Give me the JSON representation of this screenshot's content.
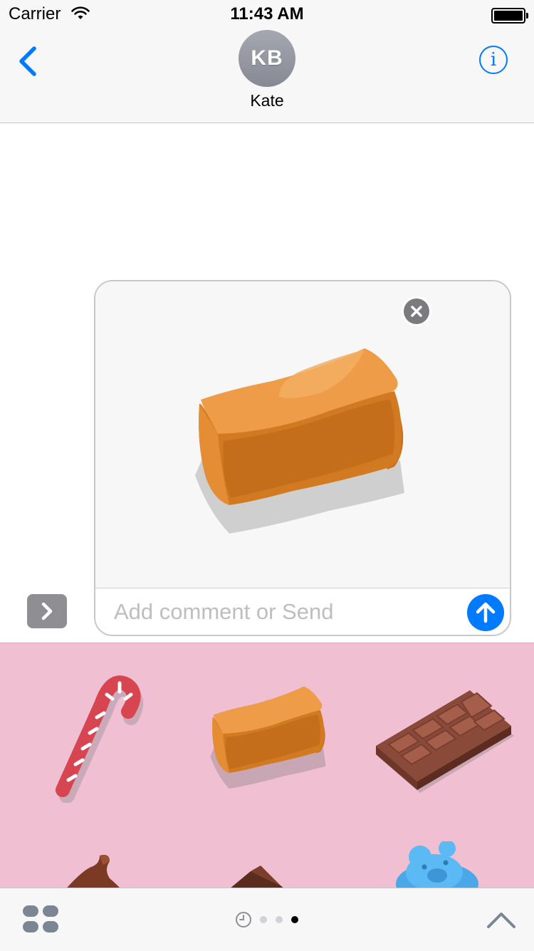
{
  "status_bar": {
    "carrier": "Carrier",
    "time": "11:43 AM"
  },
  "header": {
    "contact_initials": "KB",
    "contact_name": "Kate",
    "info_glyph": "i"
  },
  "compose": {
    "placeholder": "Add comment or Send",
    "selected_sticker": "caramel-sticker",
    "close_icon": "close-icon",
    "send_icon": "arrow-up-icon"
  },
  "sticker_drawer": {
    "background_color": "#f1bfd2",
    "stickers": [
      "candy-cane-sticker",
      "caramel-sticker",
      "chocolate-bar-sticker",
      "chocolate-kiss-sticker",
      "chocolate-chunk-sticker",
      "gummy-bear-sticker"
    ]
  },
  "bottom_bar": {
    "apps_icon": "app-drawer-icon",
    "recents_icon": "clock-icon",
    "page_count": 3,
    "active_page": 3,
    "expand_icon": "chevron-up-icon"
  },
  "colors": {
    "accent": "#007aff",
    "header_bg": "#f7f7f7"
  }
}
